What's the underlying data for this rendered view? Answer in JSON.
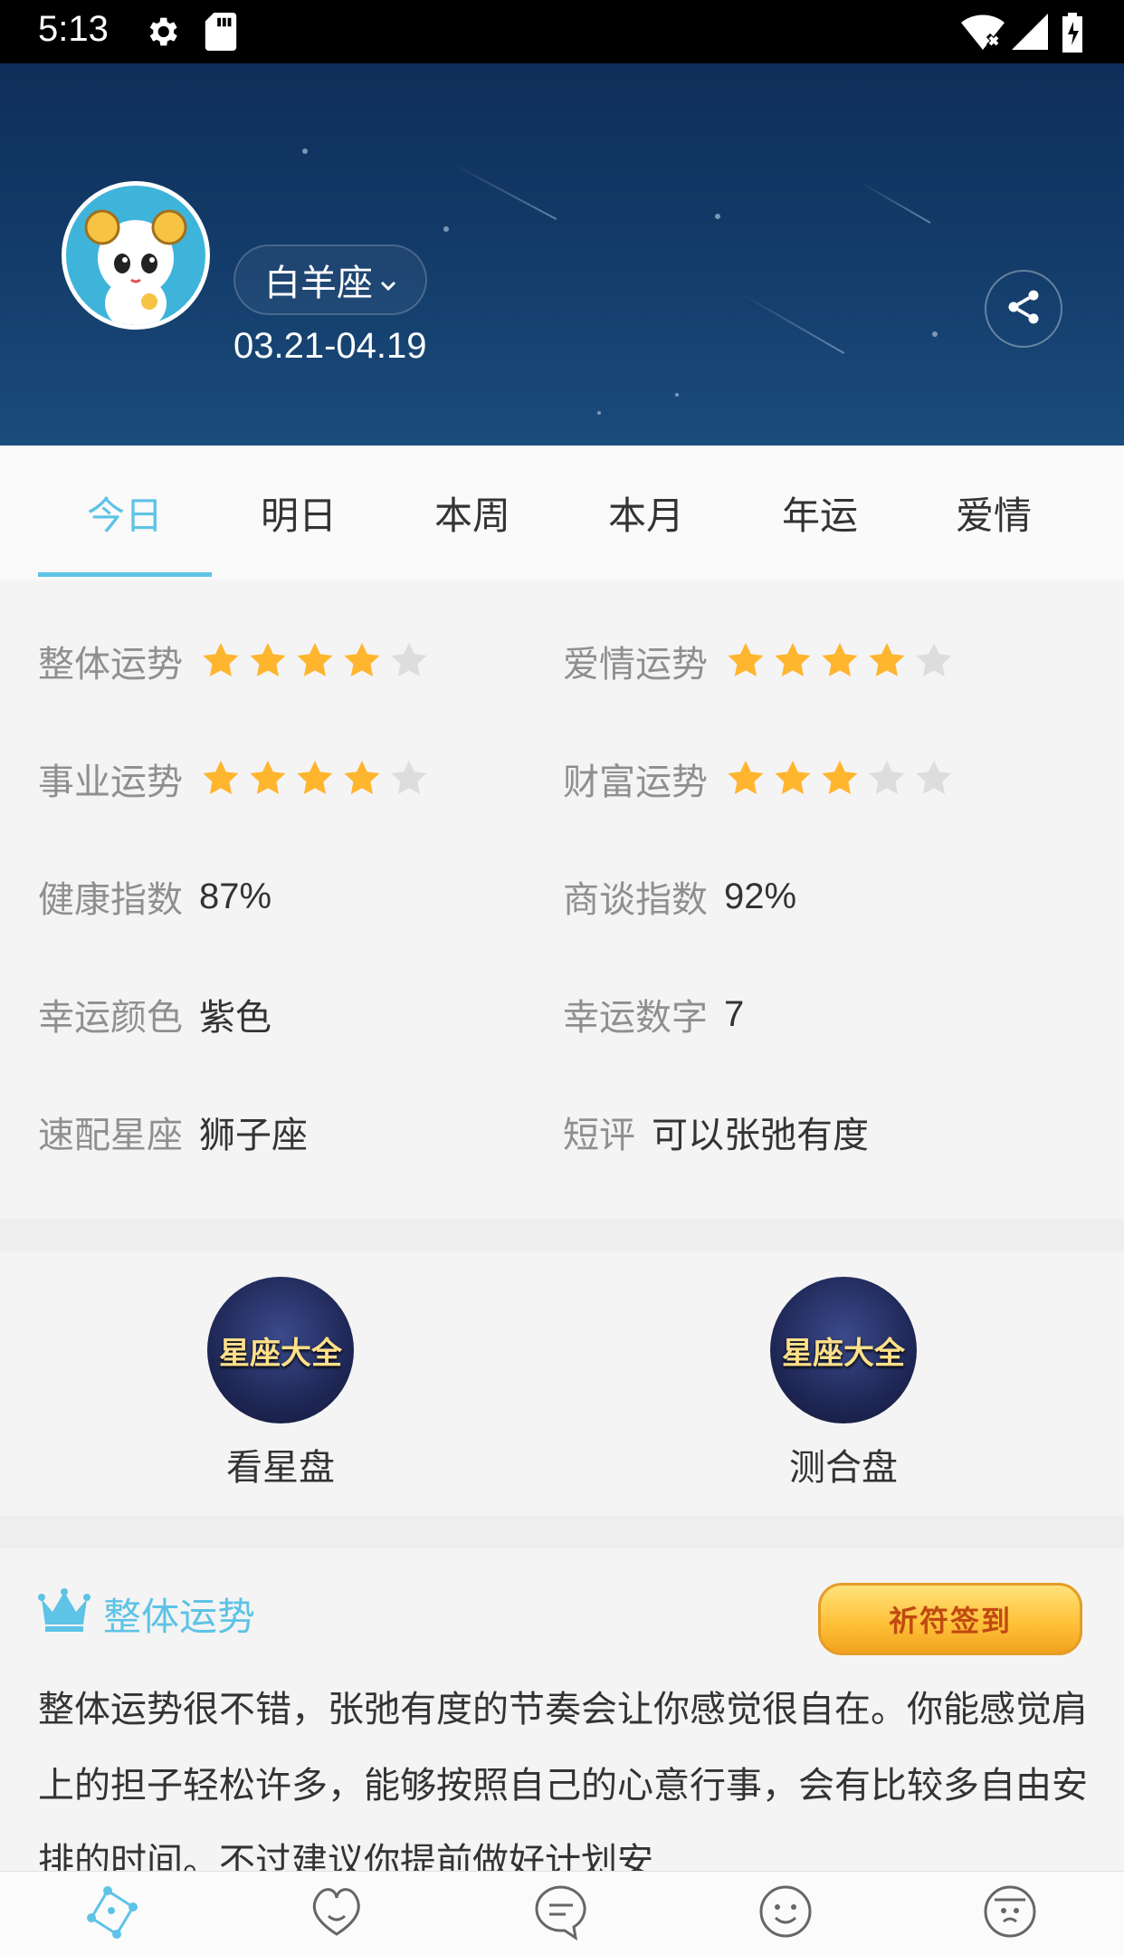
{
  "status_bar": {
    "time": "5:13"
  },
  "header": {
    "sign_name": "白羊座",
    "date_range": "03.21-04.19"
  },
  "tabs": [
    {
      "label": "今日",
      "active": true
    },
    {
      "label": "明日",
      "active": false
    },
    {
      "label": "本周",
      "active": false
    },
    {
      "label": "本月",
      "active": false
    },
    {
      "label": "年运",
      "active": false
    },
    {
      "label": "爱情",
      "active": false
    }
  ],
  "fortune": {
    "overall": {
      "label": "整体运势",
      "stars": 4,
      "max": 5
    },
    "love": {
      "label": "爱情运势",
      "stars": 4,
      "max": 5
    },
    "career": {
      "label": "事业运势",
      "stars": 4,
      "max": 5
    },
    "wealth": {
      "label": "财富运势",
      "stars": 3,
      "max": 5
    },
    "health": {
      "label": "健康指数",
      "value": "87%"
    },
    "negotiation": {
      "label": "商谈指数",
      "value": "92%"
    },
    "lucky_color": {
      "label": "幸运颜色",
      "value": "紫色"
    },
    "lucky_number": {
      "label": "幸运数字",
      "value": "7"
    },
    "match_sign": {
      "label": "速配星座",
      "value": "狮子座"
    },
    "comment": {
      "label": "短评",
      "value": "可以张弛有度"
    }
  },
  "tools": [
    {
      "badge": "星座大全",
      "label": "看星盘"
    },
    {
      "badge": "星座大全",
      "label": "测合盘"
    }
  ],
  "overall_section": {
    "title": "整体运势",
    "checkin_label": "祈符签到",
    "text": "整体运势很不错，张弛有度的节奏会让你感觉很自在。你能感觉肩上的担子轻松许多，能够按照自己的心意行事，会有比较多自由安排的时间。不过建议你提前做好计划安"
  },
  "colors": {
    "accent": "#5ec3e6",
    "star_on": "#ffb52e",
    "star_off": "#dddddd",
    "header_bg": "#143d6b"
  },
  "icons": [
    "settings-icon",
    "sd-card-icon",
    "wifi-icon",
    "signal-icon",
    "battery-icon",
    "chevron-down-icon",
    "share-icon",
    "crown-icon",
    "constellation-icon",
    "love-face-icon",
    "chat-icon",
    "smile-icon",
    "profile-icon"
  ]
}
